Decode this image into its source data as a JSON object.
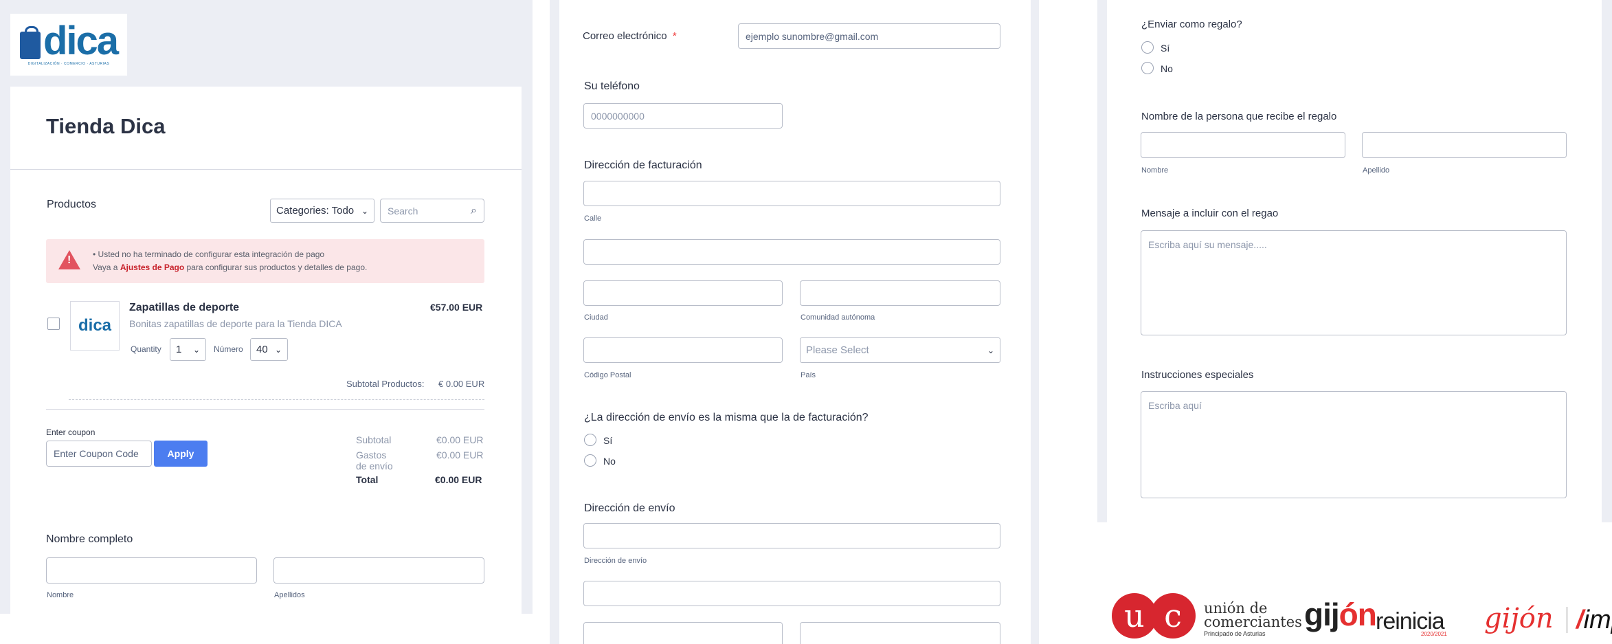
{
  "panel1": {
    "logo_word": "dica",
    "logo_tagline": "DIGITALIZACIÓN · COMERCIO · ASTURIAS",
    "store_title": "Tienda Dica",
    "products_label": "Productos",
    "categories_select": "Categories: Todo",
    "search_placeholder": "Search",
    "alert_line1": "Usted no ha terminado de configurar esta integración de pago",
    "alert_line2_pre": "Vaya a ",
    "alert_line2_link": "Ajustes de Pago",
    "alert_line2_post": " para configurar sus productos y detalles de pago.",
    "product": {
      "name": "Zapatillas de deporte",
      "description": "Bonitas zapatillas de deporte para la Tienda DICA",
      "price": "€57.00 EUR",
      "quantity_label": "Quantity",
      "quantity_value": "1",
      "numero_label": "Número",
      "numero_value": "40",
      "thumb_word": "dica"
    },
    "subtotal_productos_label": "Subtotal Productos:",
    "subtotal_productos_value": "€ 0.00 EUR",
    "coupon_label": "Enter coupon",
    "coupon_placeholder": "Enter Coupon Code",
    "apply_label": "Apply",
    "subtotal_label": "Subtotal",
    "subtotal_value": "€0.00 EUR",
    "gastos_label_1": "Gastos",
    "gastos_label_2": "de envío",
    "gastos_value": "€0.00 EUR",
    "total_label": "Total",
    "total_value": "€0.00 EUR",
    "nombre_completo_label": "Nombre completo",
    "nombre_sub": "Nombre",
    "apellidos_sub": "Apellidos"
  },
  "panel2": {
    "email_label": "Correo electrónico",
    "required_mark": "*",
    "email_value": "ejemplo sunombre@gmail.com",
    "phone_label": "Su teléfono",
    "phone_placeholder": "0000000000",
    "billing_label": "Dirección de facturación",
    "calle_sub": "Calle",
    "ciudad_sub": "Ciudad",
    "comunidad_sub": "Comunidad autónoma",
    "codigo_postal_sub": "Código Postal",
    "pais_sub": "País",
    "pais_select": "Please Select",
    "same_address_question": "¿La dirección de envío es la misma que la de facturación?",
    "option_si": "Sí",
    "option_no": "No",
    "shipping_label": "Dirección de envío",
    "shipping_sub": "Dirección de envío"
  },
  "panel3": {
    "gift_question": "¿Enviar como regalo?",
    "option_si": "Sí",
    "option_no": "No",
    "recipient_label": "Nombre de la persona que recibe el regalo",
    "nombre_sub": "Nombre",
    "apellido_sub": "Apellido",
    "message_label": "Mensaje a incluir con el regao",
    "message_placeholder": "Escriba aquí su mensaje.....",
    "instructions_label": "Instrucciones especiales",
    "instructions_placeholder": "Escriba aquí"
  },
  "sponsors": {
    "uc_letters": "uc",
    "uc_line1": "unión de",
    "uc_line2": "comerciantes",
    "uc_sub": "Principado de Asturias",
    "gijon_reinicia_a": "gij",
    "gijon_reinicia_o": "ón",
    "gijon_reinicia_b": "reinicia",
    "gijon_reinicia_years": "2020/2021",
    "gijon_logo": "gijón",
    "impulsa_slash": "/",
    "impulsa_text": "impu"
  },
  "colors": {
    "accent_blue": "#4c7df0",
    "alert_bg": "#fbe6e8",
    "alert_red": "#e2535f",
    "brand_blue": "#1b6ea8",
    "sponsor_red": "#d7262f"
  }
}
